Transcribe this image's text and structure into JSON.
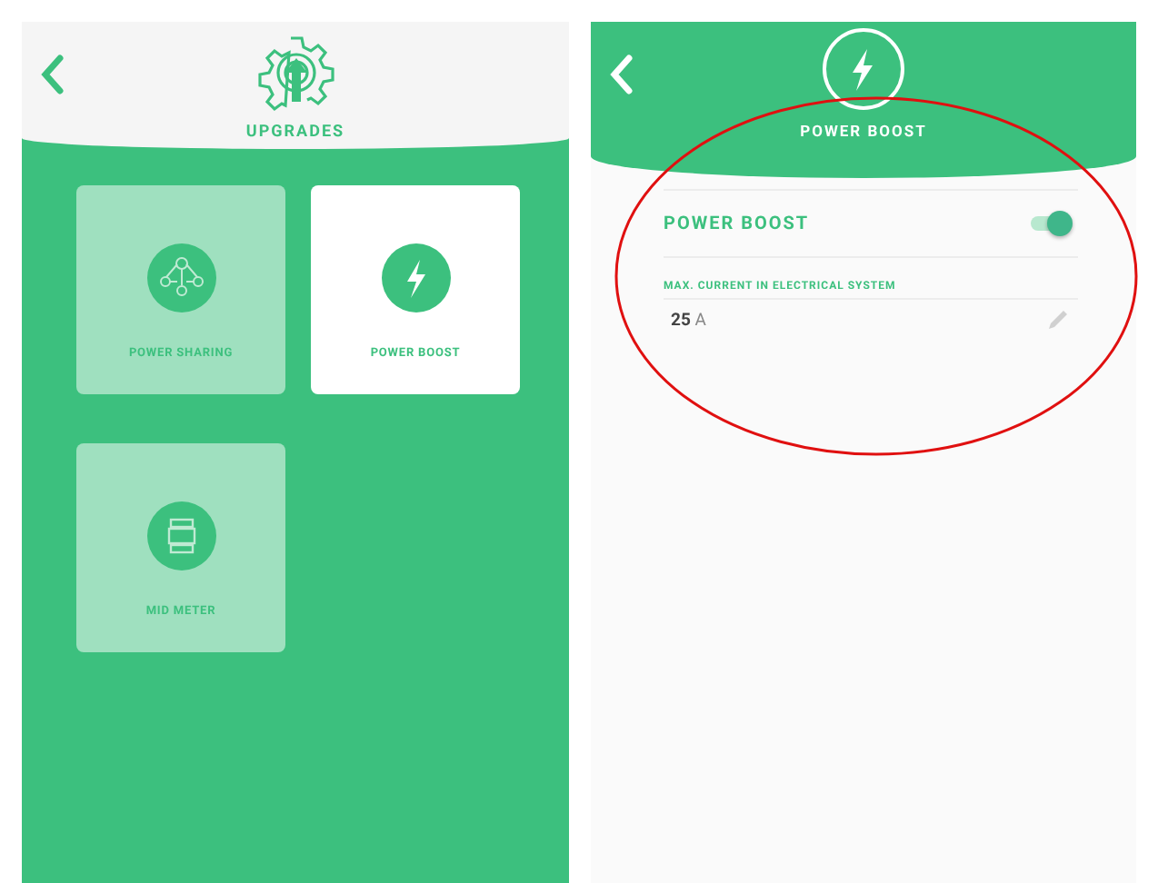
{
  "upgrades_screen": {
    "title": "UPGRADES",
    "tiles": [
      {
        "label": "POWER SHARING",
        "kind": "sharing",
        "selected": false
      },
      {
        "label": "POWER BOOST",
        "kind": "boost",
        "selected": true
      },
      {
        "label": "MID METER",
        "kind": "meter",
        "selected": false
      }
    ]
  },
  "boost_screen": {
    "title": "POWER BOOST",
    "toggle": {
      "label": "POWER BOOST",
      "on": true
    },
    "field": {
      "label": "MAX. CURRENT IN ELECTRICAL SYSTEM",
      "value": "25",
      "unit": "A"
    }
  }
}
